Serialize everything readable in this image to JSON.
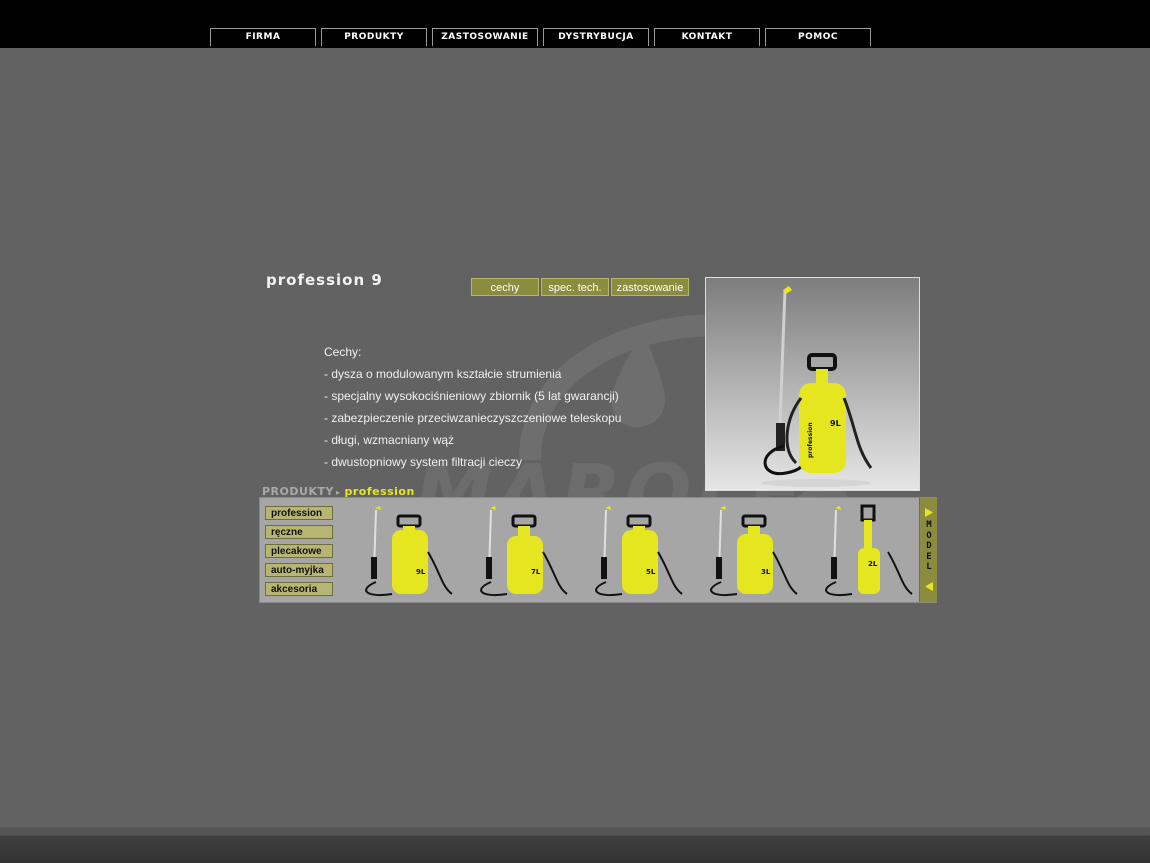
{
  "nav": {
    "items": [
      {
        "label": "FIRMA"
      },
      {
        "label": "PRODUKTY"
      },
      {
        "label": "ZASTOSOWANIE"
      },
      {
        "label": "DYSTRYBUCJA"
      },
      {
        "label": "KONTAKT"
      },
      {
        "label": "POMOC"
      }
    ]
  },
  "watermark": {
    "text": "MAROLEX"
  },
  "product": {
    "title": "profession 9",
    "tabs": [
      {
        "label": "cechy"
      },
      {
        "label": "spec. tech."
      },
      {
        "label": "zastosowanie"
      }
    ],
    "features": {
      "heading": "Cechy:",
      "items": [
        "- dysza o modulowanym kształcie strumienia",
        "- specjalny wysokociśnieniowy zbiornik (5 lat gwarancji)",
        "- zabezpieczenie przeciwzanieczyszczeniowe teleskopu",
        "- długi, wzmacniany wąż",
        "- dwustopniowy system filtracji cieczy"
      ]
    },
    "photo_badge": "9L",
    "photo_brand": "profession"
  },
  "breadcrumb": {
    "root": "PRODUKTY",
    "arrow": "▸",
    "current": "profession"
  },
  "categories": [
    {
      "label": "profession"
    },
    {
      "label": "ręczne"
    },
    {
      "label": "plecakowe"
    },
    {
      "label": "auto-myjka"
    },
    {
      "label": "akcesoria"
    }
  ],
  "models": [
    {
      "badge": "9L"
    },
    {
      "badge": "7L"
    },
    {
      "badge": "5L"
    },
    {
      "badge": "3L"
    },
    {
      "badge": "2L"
    }
  ],
  "model_scroller": {
    "label": "MODEL"
  },
  "colors": {
    "accent": "#e6e620",
    "olive": "#8c8c3e",
    "background": "#626262"
  }
}
